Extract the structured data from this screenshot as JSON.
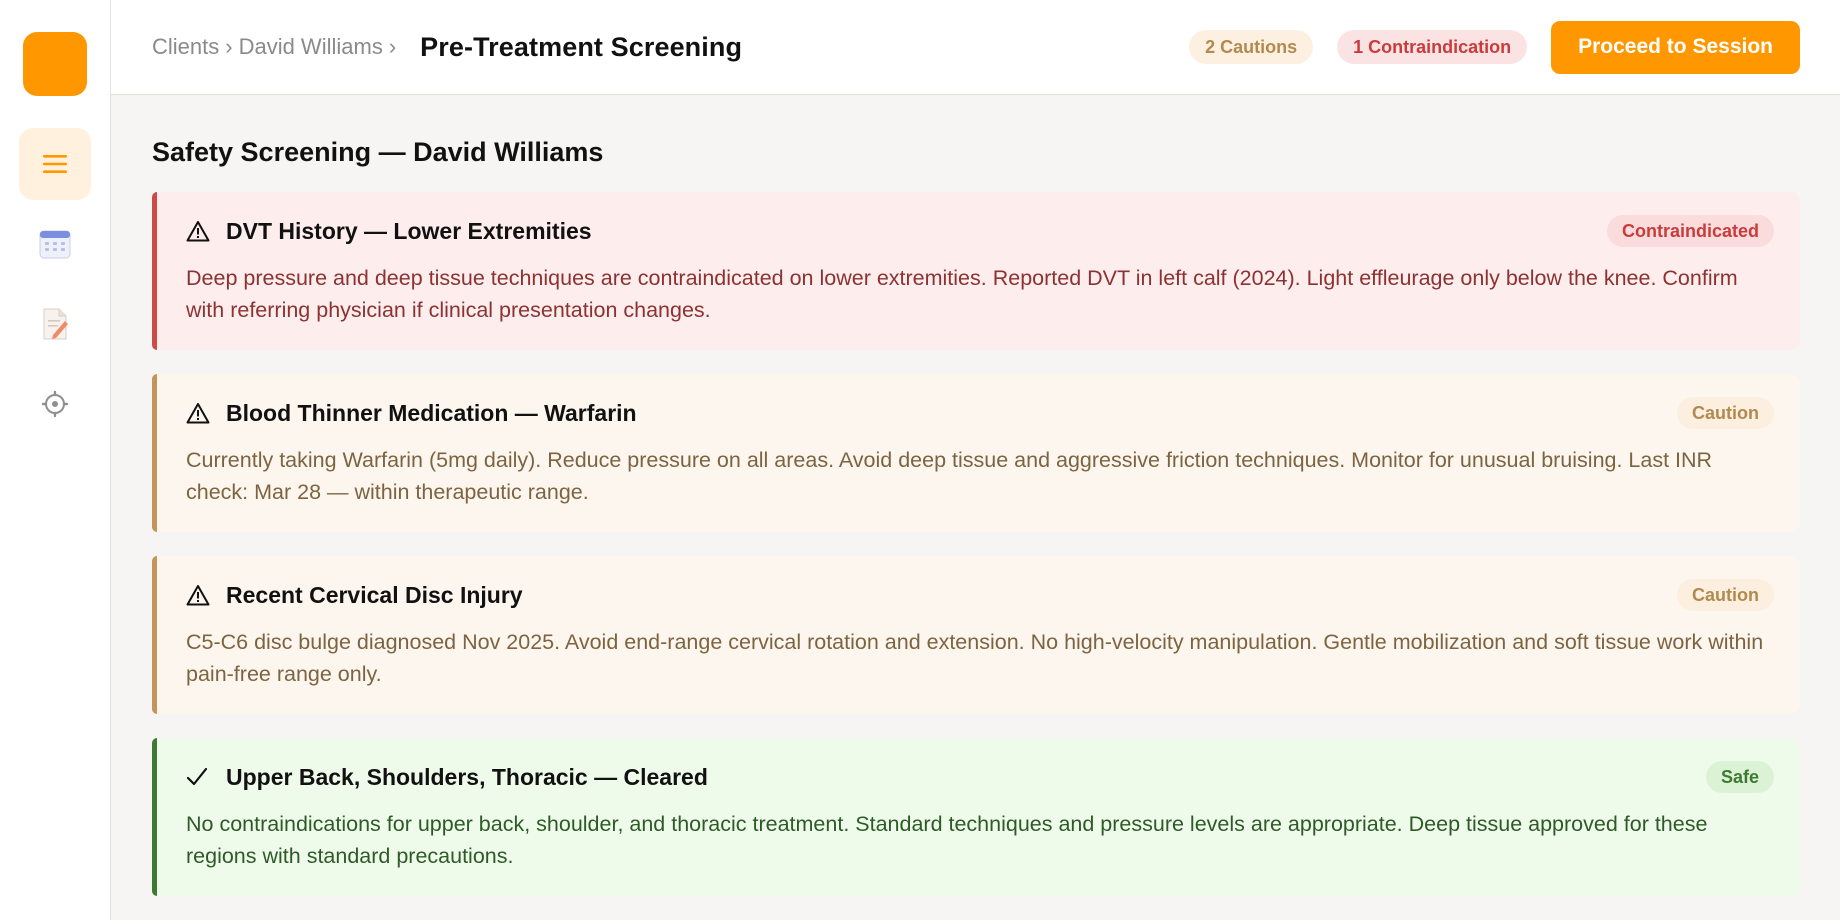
{
  "breadcrumb": {
    "items": [
      "Clients",
      "David Williams"
    ],
    "separator": "›"
  },
  "page_title": "Pre-Treatment Screening",
  "header": {
    "cautions_pill": "2 Cautions",
    "contra_pill": "1 Contraindication",
    "proceed_label": "Proceed to Session"
  },
  "sidebar": {
    "items": [
      {
        "icon": "list-icon",
        "active": true
      },
      {
        "icon": "calendar-icon",
        "active": false
      },
      {
        "icon": "document-icon",
        "active": false
      },
      {
        "icon": "gear-icon",
        "active": false
      }
    ]
  },
  "section_title": "Safety Screening — David Williams",
  "cards": [
    {
      "level": "contraindicated",
      "icon": "warning-icon",
      "title": "DVT History — Lower Extremities",
      "badge": "Contraindicated",
      "body": "Deep pressure and deep tissue techniques are contraindicated on lower extremities. Reported DVT in left calf (2024). Light effleurage only below the knee. Confirm with referring physician if clinical presentation changes."
    },
    {
      "level": "caution",
      "icon": "warning-icon",
      "title": "Blood Thinner Medication — Warfarin",
      "badge": "Caution",
      "body": "Currently taking Warfarin (5mg daily). Reduce pressure on all areas. Avoid deep tissue and aggressive friction techniques. Monitor for unusual bruising. Last INR check: Mar 28 — within therapeutic range."
    },
    {
      "level": "caution",
      "icon": "warning-icon",
      "title": "Recent Cervical Disc Injury",
      "badge": "Caution",
      "body": "C5-C6 disc bulge diagnosed Nov 2025. Avoid end-range cervical rotation and extension. No high-velocity manipulation. Gentle mobilization and soft tissue work within pain-free range only."
    },
    {
      "level": "safe",
      "icon": "check-icon",
      "title": "Upper Back, Shoulders, Thoracic — Cleared",
      "badge": "Safe",
      "body": "No contraindications for upper back, shoulder, and thoracic treatment. Standard techniques and pressure levels are appropriate. Deep tissue approved for these regions with standard precautions."
    }
  ],
  "colors": {
    "accent": "#ff9800",
    "contraindicated": "#cd4a4a",
    "caution": "#c3955a",
    "safe": "#3e7a34"
  }
}
